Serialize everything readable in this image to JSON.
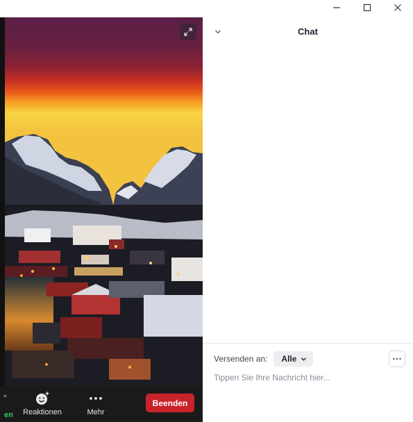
{
  "window": {
    "controls": [
      {
        "name": "minimize",
        "icon": "minimize-icon"
      },
      {
        "name": "maximize",
        "icon": "maximize-icon"
      },
      {
        "name": "close",
        "icon": "close-icon"
      }
    ]
  },
  "video": {
    "expand_icon": "expand-icon",
    "toolbar": {
      "partial_label": "en",
      "reactions_label": "Reaktionen",
      "reactions_icon": "smiley-plus-icon",
      "more_label": "Mehr",
      "more_icon": "ellipsis-icon",
      "end_label": "Beenden",
      "end_color": "#c9232a"
    }
  },
  "chat": {
    "title": "Chat",
    "collapse_icon": "chevron-down-icon",
    "send_to_label": "Versenden an:",
    "recipient": "Alle",
    "more_options_icon": "ellipsis-icon",
    "input_placeholder": "Tippen Sie Ihre Nachricht hier..."
  }
}
